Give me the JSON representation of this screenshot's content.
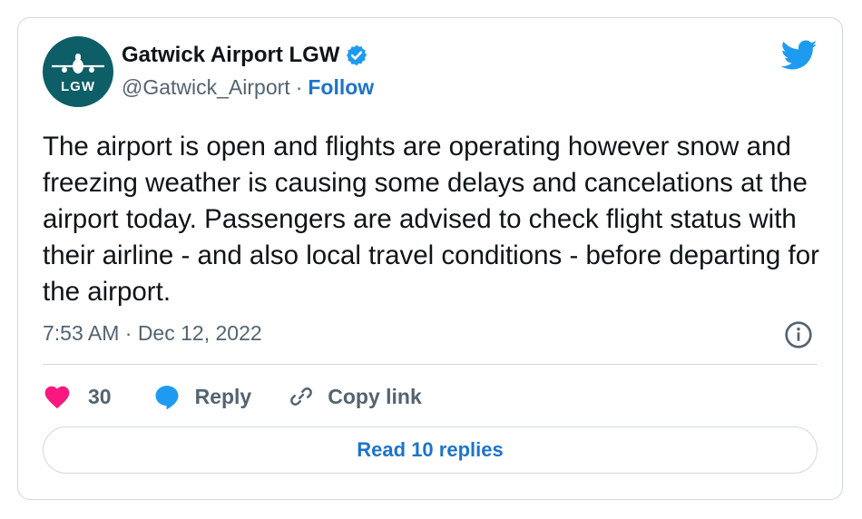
{
  "account": {
    "display_name": "Gatwick Airport LGW",
    "handle": "@Gatwick_Airport",
    "separator": "·",
    "follow_label": "Follow",
    "avatar_text": "LGW",
    "verified": true
  },
  "tweet": {
    "text": "The airport is open and flights are operating however snow and freezing weather is causing some delays and cancelations at the airport today. Passengers are advised to check flight status with their airline - and also local travel conditions - before departing for the airport.",
    "timestamp": "7:53 AM · Dec 12, 2022"
  },
  "actions": {
    "like_count": "30",
    "reply_label": "Reply",
    "copy_link_label": "Copy link"
  },
  "read_replies_label": "Read 10 replies",
  "icons": [
    "twitter-bird-icon",
    "verified-badge-icon",
    "info-icon",
    "heart-icon",
    "reply-bubble-icon",
    "link-icon",
    "plane-icon"
  ],
  "colors": {
    "avatar_bg": "#0d5e67",
    "link_blue": "#1d74c9",
    "twitter_blue": "#1d9bf0",
    "heart_pink": "#f91880",
    "muted_text": "#536471",
    "border": "#cfd9de"
  }
}
